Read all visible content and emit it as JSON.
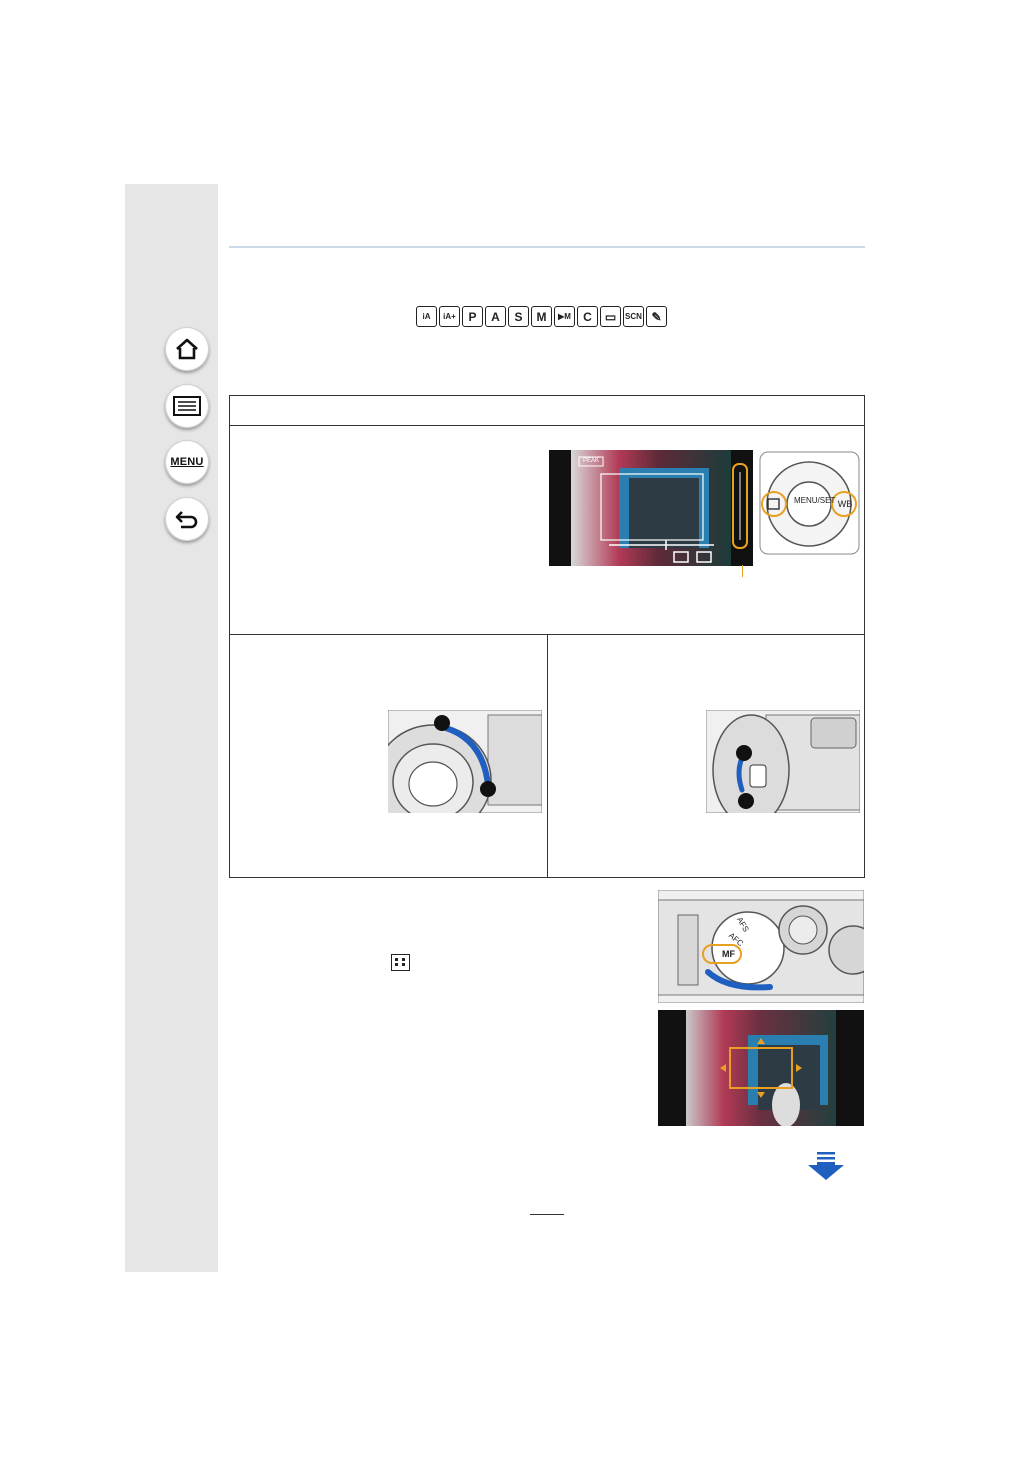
{
  "nav": {
    "home": "home-icon",
    "contents": "list-icon",
    "menu_label": "MENU",
    "back": "back-icon"
  },
  "modes": [
    {
      "label": "iA"
    },
    {
      "label": "iA+"
    },
    {
      "label": "P"
    },
    {
      "label": "A"
    },
    {
      "label": "S"
    },
    {
      "label": "M"
    },
    {
      "label": "▶M"
    },
    {
      "label": "C"
    },
    {
      "label": "▭"
    },
    {
      "label": "SCN"
    },
    {
      "label": "✎"
    }
  ],
  "camera_screen": {
    "badge": "PEAK",
    "menu_set_label": "MENU/SET",
    "wb_label": "WB"
  },
  "colors": {
    "accent_orange": "#e8a020",
    "arrow_blue": "#1f5fbf",
    "sidebar_gray": "#e6e6e6",
    "rule_blue": "#cdd8ea"
  },
  "dial": {
    "afs": "AFS",
    "afc": "AFC",
    "mf": "MF"
  }
}
